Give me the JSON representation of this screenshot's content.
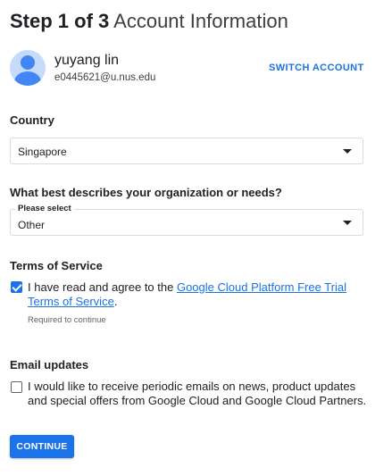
{
  "header": {
    "step": "Step 1 of 3",
    "title": "Account Information"
  },
  "account": {
    "name": "yuyang lin",
    "email": "e0445621@u.nus.edu",
    "switch_label": "SWITCH ACCOUNT",
    "avatar_icon": "person-icon"
  },
  "country": {
    "label": "Country",
    "value": "Singapore"
  },
  "organization": {
    "label": "What best describes your organization or needs?",
    "floating_label": "Please select",
    "value": "Other"
  },
  "terms": {
    "label": "Terms of Service",
    "checked": true,
    "text_prefix": "I have read and agree to the ",
    "link_text": "Google Cloud Platform Free Trial Terms of Service",
    "text_suffix": ".",
    "helper": "Required to continue"
  },
  "email_updates": {
    "label": "Email updates",
    "checked": false,
    "text": "I would like to receive periodic emails on news, product updates and special offers from Google Cloud and Google Cloud Partners."
  },
  "actions": {
    "continue_label": "CONTINUE"
  },
  "colors": {
    "accent": "#1a73e8",
    "avatar_bg": "#c6dafc"
  }
}
